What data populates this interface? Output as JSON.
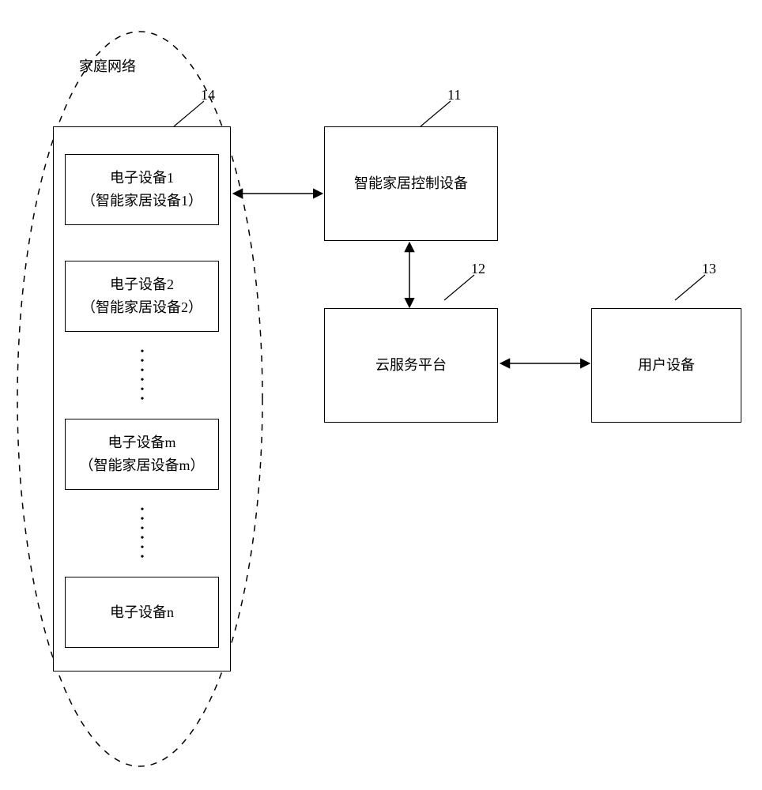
{
  "group": {
    "title": "家庭网络",
    "ref": "14"
  },
  "devices": [
    {
      "line1": "电子设备1",
      "line2": "（智能家居设备1）"
    },
    {
      "line1": "电子设备2",
      "line2": "（智能家居设备2）"
    },
    {
      "line1": "电子设备m",
      "line2": "（智能家居设备m）"
    },
    {
      "line1": "电子设备n",
      "line2": ""
    }
  ],
  "nodes": {
    "controller": {
      "label": "智能家居控制设备",
      "ref": "11"
    },
    "cloud": {
      "label": "云服务平台",
      "ref": "12"
    },
    "user": {
      "label": "用户设备",
      "ref": "13"
    }
  }
}
